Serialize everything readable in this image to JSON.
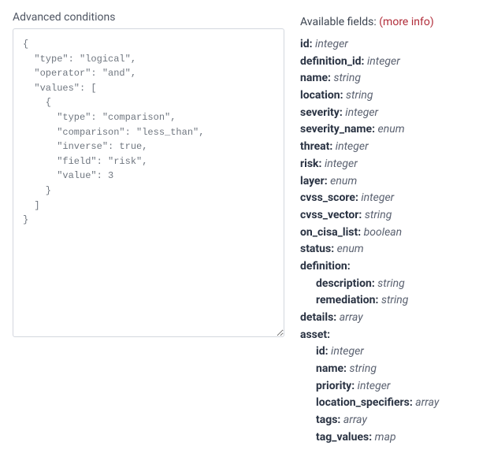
{
  "left": {
    "label": "Advanced conditions",
    "json_text": "{\n  \"type\": \"logical\",\n  \"operator\": \"and\",\n  \"values\": [\n    {\n      \"type\": \"comparison\",\n      \"comparison\": \"less_than\",\n      \"inverse\": true,\n      \"field\": \"risk\",\n      \"value\": 3\n    }\n  ]\n}"
  },
  "right": {
    "header": "Available fields:",
    "more_info": "(more info)",
    "fields": [
      {
        "name": "id:",
        "type": "integer"
      },
      {
        "name": "definition_id:",
        "type": "integer"
      },
      {
        "name": "name:",
        "type": "string"
      },
      {
        "name": "location:",
        "type": "string"
      },
      {
        "name": "severity:",
        "type": "integer"
      },
      {
        "name": "severity_name:",
        "type": "enum"
      },
      {
        "name": "threat:",
        "type": "integer"
      },
      {
        "name": "risk:",
        "type": "integer"
      },
      {
        "name": "layer:",
        "type": "enum"
      },
      {
        "name": "cvss_score:",
        "type": "integer"
      },
      {
        "name": "cvss_vector:",
        "type": "string"
      },
      {
        "name": "on_cisa_list:",
        "type": "boolean"
      },
      {
        "name": "status:",
        "type": "enum"
      },
      {
        "name": "definition:",
        "type": "",
        "children": [
          {
            "name": "description:",
            "type": "string"
          },
          {
            "name": "remediation:",
            "type": "string"
          }
        ]
      },
      {
        "name": "details:",
        "type": "array"
      },
      {
        "name": "asset:",
        "type": "",
        "children": [
          {
            "name": "id:",
            "type": "integer"
          },
          {
            "name": "name:",
            "type": "string"
          },
          {
            "name": "priority:",
            "type": "integer"
          },
          {
            "name": "location_specifiers:",
            "type": "array"
          },
          {
            "name": "tags:",
            "type": "array"
          },
          {
            "name": "tag_values:",
            "type": "map"
          }
        ]
      }
    ]
  }
}
